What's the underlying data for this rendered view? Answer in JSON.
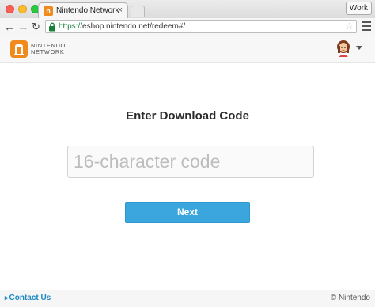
{
  "browser": {
    "tab_title": "Nintendo Network",
    "tab_favicon": "n",
    "tab_close": "×",
    "profile_label": "Work",
    "url_scheme": "https://",
    "url_rest": "eshop.nintendo.net/redeem#/",
    "back_glyph": "←",
    "forward_glyph": "→",
    "reload_glyph": "↻",
    "star_glyph": "☆"
  },
  "header": {
    "logo_line1": "NINTENDO",
    "logo_line2": "NETWORK"
  },
  "main": {
    "heading": "Enter Download Code",
    "code_placeholder": "16-character code",
    "code_value": "",
    "next_label": "Next"
  },
  "footer": {
    "contact_arrow": "▸",
    "contact_label": "Contact Us",
    "copyright": "© Nintendo"
  },
  "colors": {
    "accent": "#3aa6dd",
    "brand_orange": "#f08a1c",
    "link": "#1d88c4"
  },
  "icons": [
    "lock-icon",
    "star-icon",
    "menu-icon",
    "nintendo-network-logo",
    "avatar",
    "chevron-down-icon"
  ]
}
